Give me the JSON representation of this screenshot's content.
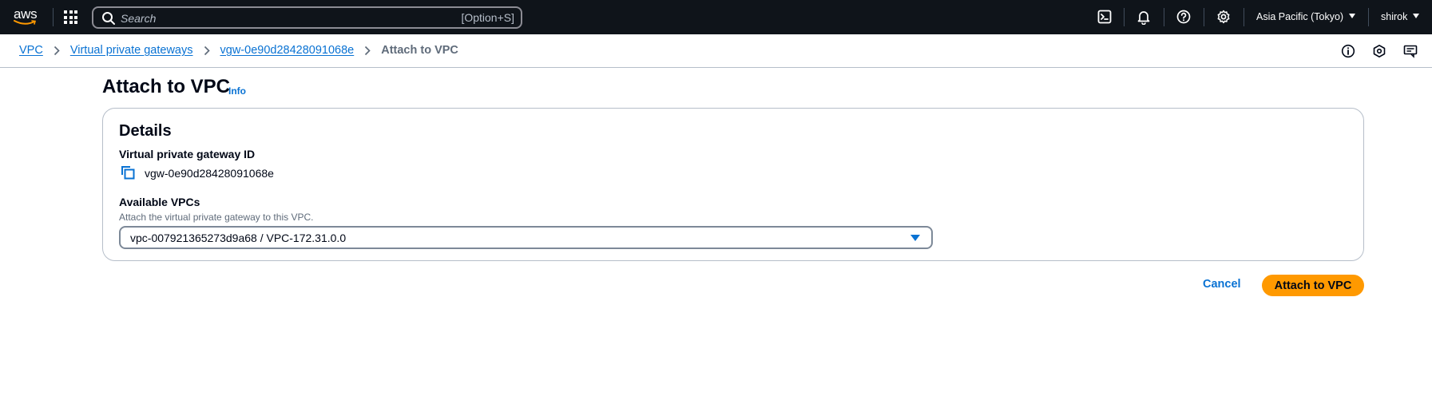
{
  "topnav": {
    "logo_text": "aws",
    "search": {
      "placeholder": "Search",
      "shortcut": "[Option+S]"
    },
    "region": "Asia Pacific (Tokyo)",
    "user": "shirok"
  },
  "breadcrumb": {
    "items": [
      {
        "label": "VPC"
      },
      {
        "label": "Virtual private gateways"
      },
      {
        "label": "vgw-0e90d28428091068e"
      }
    ],
    "current": "Attach to VPC"
  },
  "page": {
    "title": "Attach to VPC",
    "info_link": "Info"
  },
  "details": {
    "title": "Details",
    "gateway_id_label": "Virtual private gateway ID",
    "gateway_id_value": "vgw-0e90d28428091068e",
    "vpcs_label": "Available VPCs",
    "vpcs_description": "Attach the virtual private gateway to this VPC.",
    "vpcs_selected": "vpc-007921365273d9a68 / VPC-172.31.0.0"
  },
  "actions": {
    "cancel_label": "Cancel",
    "submit_label": "Attach to VPC"
  },
  "colors": {
    "nav_background": "#0f141a",
    "link_blue": "#0972d3",
    "primary_orange": "#ff9900",
    "border_gray": "#b6bec9"
  }
}
